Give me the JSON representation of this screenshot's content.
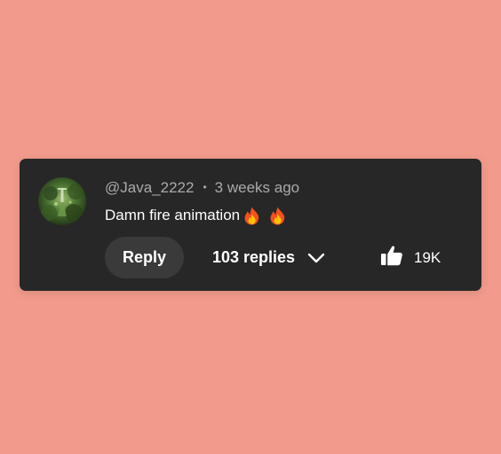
{
  "comment": {
    "author": "@Java_2222",
    "separator": "•",
    "time": "3 weeks ago",
    "text": "Damn fire animation",
    "emojis": [
      "fire-emoji",
      "fire-emoji"
    ],
    "reply_label": "Reply",
    "replies_label": "103 replies",
    "like_count": "19K"
  },
  "icons": {
    "avatar": "avatar-image",
    "chevron": "chevron-down-icon",
    "like": "thumbs-up-icon"
  },
  "colors": {
    "background": "#f29b8c",
    "card": "#272727",
    "reply_button": "#3a3a3a",
    "meta_text": "#aaaaaa",
    "primary_text": "#ffffff"
  }
}
